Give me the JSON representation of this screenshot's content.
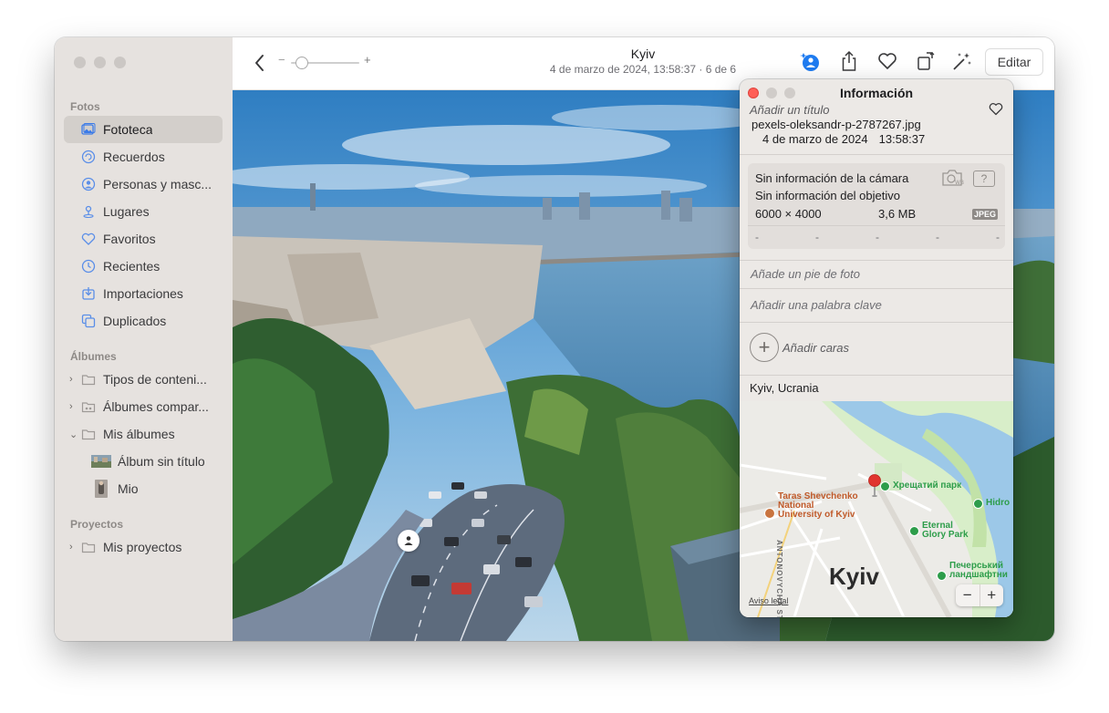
{
  "sidebar": {
    "fotos_header": "Fotos",
    "fotos": [
      {
        "label": "Fototeca",
        "icon": "photo-library-icon",
        "selected": true
      },
      {
        "label": "Recuerdos",
        "icon": "memories-icon"
      },
      {
        "label": "Personas y masc...",
        "icon": "people-icon"
      },
      {
        "label": "Lugares",
        "icon": "places-icon"
      },
      {
        "label": "Favoritos",
        "icon": "heart-icon"
      },
      {
        "label": "Recientes",
        "icon": "clock-icon"
      },
      {
        "label": "Importaciones",
        "icon": "import-icon"
      },
      {
        "label": "Duplicados",
        "icon": "duplicates-icon"
      }
    ],
    "albums_header": "Álbumes",
    "albums": [
      {
        "label": "Tipos de conteni...",
        "icon": "folder-icon",
        "chevron": "›"
      },
      {
        "label": "Álbumes compar...",
        "icon": "shared-folder-icon",
        "chevron": "›"
      },
      {
        "label": "Mis álbumes",
        "icon": "folder-icon",
        "chevron": "⌄"
      },
      {
        "label": "Álbum sin título",
        "icon": "album-thumbnail"
      },
      {
        "label": "Mio",
        "icon": "album-thumbnail"
      }
    ],
    "projects_header": "Proyectos",
    "projects": [
      {
        "label": "Mis proyectos",
        "icon": "folder-icon",
        "chevron": "›"
      }
    ]
  },
  "toolbar": {
    "title": "Kyiv",
    "subtitle": "4 de marzo de 2024, 13:58:37  ·  6 de 6",
    "zoom_minus": "−",
    "zoom_plus": "+",
    "zoom_level": 0.08,
    "edit_label": "Editar"
  },
  "info": {
    "title": "Información",
    "add_title_placeholder": "Añadir un título",
    "filename": "pexels-oleksandr-p-2787267.jpg",
    "date": "4 de marzo de 2024",
    "time": "13:58:37",
    "camera": "Sin información de la cámara",
    "lens": "Sin información del objetivo",
    "resolution": "6000 × 4000",
    "size": "3,6 MB",
    "format_badge": "JPEG",
    "dashes": [
      "-",
      "-",
      "-",
      "-",
      "-"
    ],
    "caption_placeholder": "Añade un pie de foto",
    "keyword_placeholder": "Añadir una palabra clave",
    "add_faces": "Añadir caras",
    "location": "Kyiv, Ucrania",
    "map": {
      "city": "Kyiv",
      "labels": {
        "university": "Taras Shevchenko National University of Kyiv",
        "park": "Хрещатий парк",
        "hidro": "Hidro",
        "eternal_glory": "Eternal Glory Park",
        "pechersk": "Печерський ландшафтни",
        "street": "ANTONOVYCHA ST"
      },
      "legal": "Aviso legal",
      "zoom_out": "−",
      "zoom_in": "+"
    }
  },
  "colors": {
    "sidebar_bg": "#e6e2df",
    "selected_bg": "#d3cfcb",
    "info_bg": "#ece9e6",
    "accent_blue": "#1e7bf0",
    "pin_red": "#e0362e",
    "map_green": "#2d9d4a"
  }
}
